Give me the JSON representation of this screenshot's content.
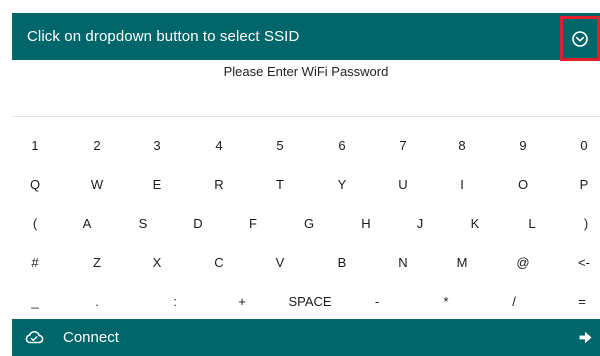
{
  "header": {
    "title": "Click on dropdown button to select SSID",
    "dropdown_icon": "chevron-down-circle-icon"
  },
  "password": {
    "prompt": "Please Enter WiFi Password",
    "value": ""
  },
  "keyboard": {
    "rows": [
      [
        "1",
        "2",
        "3",
        "4",
        "5",
        "6",
        "7",
        "8",
        "9",
        "0"
      ],
      [
        "Q",
        "W",
        "E",
        "R",
        "T",
        "Y",
        "U",
        "I",
        "O",
        "P"
      ],
      [
        "(",
        "A",
        "S",
        "D",
        "F",
        "G",
        "H",
        "J",
        "K",
        "L",
        ")"
      ],
      [
        "#",
        "Z",
        "X",
        "C",
        "V",
        "B",
        "N",
        "M",
        "@",
        "<-"
      ],
      [
        "_",
        ".",
        ":",
        "+",
        "SPACE",
        "-",
        "*",
        "/",
        "="
      ]
    ]
  },
  "footer": {
    "label": "Connect",
    "icon": "cloud-icon",
    "arrow_icon": "arrow-right-icon"
  },
  "colors": {
    "header_bg": "#00666a",
    "highlight": "#e0202c"
  }
}
